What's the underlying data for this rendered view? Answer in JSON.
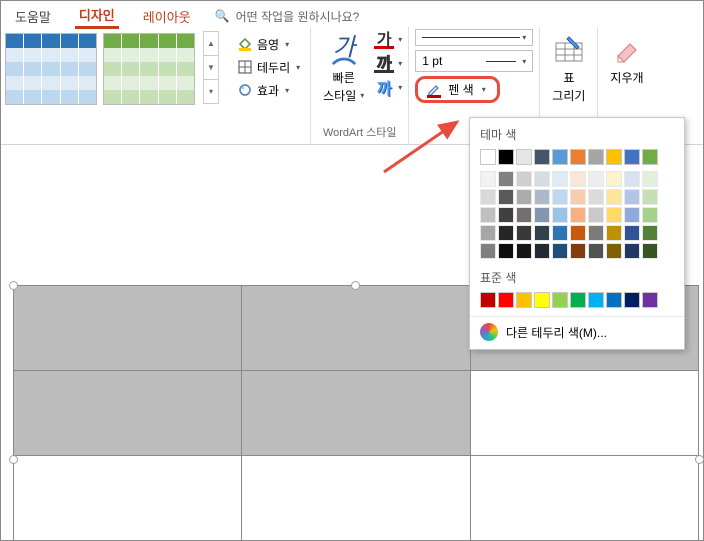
{
  "tabs": {
    "help": "도움말",
    "design": "디자인",
    "layout": "레이아웃",
    "search_hint": "어떤 작업을 원하시나요?"
  },
  "ribbon": {
    "shading": "음영",
    "border": "테두리",
    "effects": "효과",
    "quick_style_line1": "빠른",
    "quick_style_line2": "스타일",
    "wordart_group": "WordArt 스타일",
    "pen_weight": "1 pt",
    "pen_color": "펜 색",
    "draw_table_line1": "표",
    "draw_table_line2": "그리기",
    "eraser": "지우개"
  },
  "dropdown": {
    "theme_colors": "테마 색",
    "standard_colors": "표준 색",
    "more_colors": "다른 테두리 색(M)...",
    "theme_row1": [
      "#ffffff",
      "#000000",
      "#e7e6e6",
      "#44546a",
      "#5b9bd5",
      "#ed7d31",
      "#a5a5a5",
      "#ffc000",
      "#4472c4",
      "#70ad47"
    ],
    "theme_shades": [
      [
        "#f2f2f2",
        "#808080",
        "#d0cece",
        "#d6dce5",
        "#deebf7",
        "#fbe5d6",
        "#ededed",
        "#fff2cc",
        "#d9e2f3",
        "#e2efda"
      ],
      [
        "#d9d9d9",
        "#595959",
        "#aeabab",
        "#adb9ca",
        "#bdd7ee",
        "#f7cbac",
        "#dbdbdb",
        "#fee599",
        "#b4c6e7",
        "#c5e0b4"
      ],
      [
        "#bfbfbf",
        "#404040",
        "#757070",
        "#8496b0",
        "#9cc3e6",
        "#f4b183",
        "#c9c9c9",
        "#ffd965",
        "#8eaadb",
        "#a8d08d"
      ],
      [
        "#a6a6a6",
        "#262626",
        "#3a3838",
        "#323f4f",
        "#2e75b6",
        "#c55a11",
        "#7b7b7b",
        "#bf9000",
        "#2f5496",
        "#538135"
      ],
      [
        "#808080",
        "#0d0d0d",
        "#171616",
        "#222a35",
        "#1e4e79",
        "#833c0b",
        "#525252",
        "#7f6000",
        "#1f3864",
        "#375623"
      ]
    ],
    "standard_row": [
      "#c00000",
      "#ff0000",
      "#ffc000",
      "#ffff00",
      "#92d050",
      "#00b050",
      "#00b0f0",
      "#0070c0",
      "#002060",
      "#7030a0"
    ]
  }
}
